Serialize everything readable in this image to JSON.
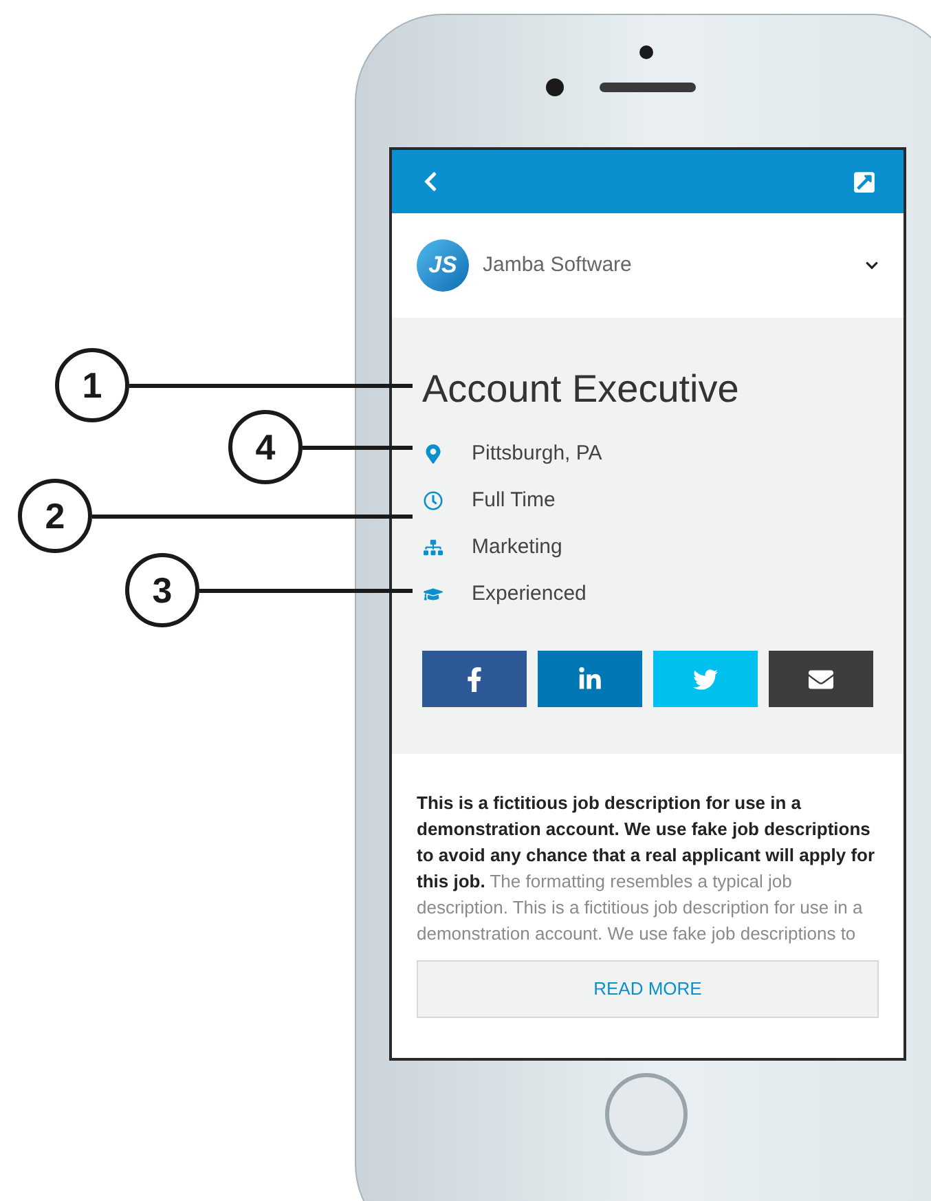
{
  "callouts": [
    {
      "number": "1"
    },
    {
      "number": "4"
    },
    {
      "number": "2"
    },
    {
      "number": "3"
    }
  ],
  "company": {
    "logo_text": "JS",
    "name": "Jamba Software"
  },
  "job": {
    "title": "Account Executive",
    "details": [
      {
        "kind": "location",
        "text": "Pittsburgh, PA"
      },
      {
        "kind": "schedule",
        "text": "Full Time"
      },
      {
        "kind": "department",
        "text": "Marketing"
      },
      {
        "kind": "level",
        "text": "Experienced"
      }
    ]
  },
  "share": [
    {
      "kind": "facebook",
      "color": "#2d5a97"
    },
    {
      "kind": "linkedin",
      "color": "#0077b5"
    },
    {
      "kind": "twitter",
      "color": "#00c0ef"
    },
    {
      "kind": "email",
      "color": "#3d3d3d"
    }
  ],
  "description": "**This is a fictitious job description for use in a demonstration account. We use fake job descriptions to avoid any chance that a real applicant will apply for this job.** The formatting resembles a typical job description. This is a fictitious job description for use in a demonstration account. We use fake job descriptions to",
  "read_more": "READ MORE"
}
